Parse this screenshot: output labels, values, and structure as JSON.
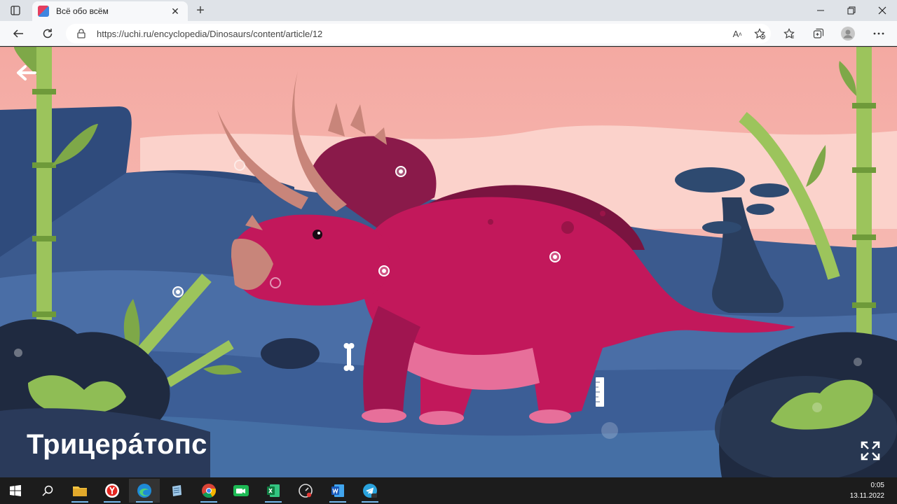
{
  "browser": {
    "tab": {
      "title": "Всё обо всём",
      "close": "✕"
    },
    "new_tab": "+",
    "window_controls": {
      "minimize": "—",
      "maximize": "❐",
      "close": "✕"
    },
    "url": "https://uchi.ru/encyclopedia/Dinosaurs/content/article/12"
  },
  "article": {
    "title": "Трицера́топс",
    "icons": [
      "back-arrow-icon",
      "bone-icon",
      "ruler-icon",
      "expand-icon"
    ],
    "colors": {
      "dinosaur": "#c2185b",
      "sky": "#f7b6b0",
      "ground": "#3a5a8c",
      "bamboo": "#9cc45c"
    }
  },
  "taskbar": {
    "apps": [
      "windows-start",
      "search",
      "file-explorer",
      "yandex-browser",
      "edge",
      "notepad",
      "chrome",
      "facetime-green",
      "excel",
      "speedometer",
      "word",
      "telegram"
    ],
    "time": "0:05",
    "date": "13.11.2022"
  }
}
